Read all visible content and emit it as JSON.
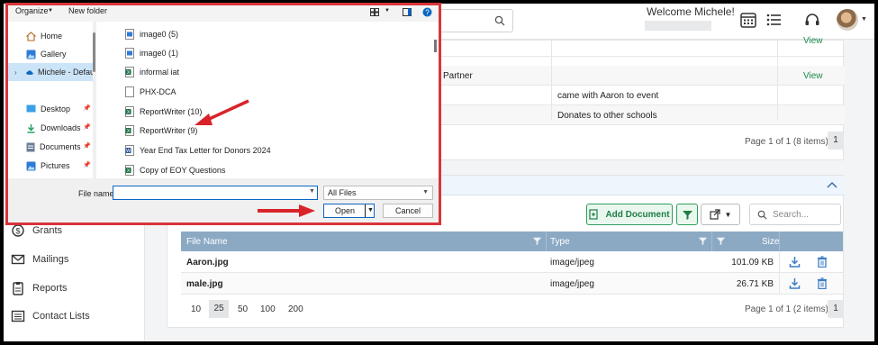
{
  "app": {
    "header": {
      "welcome": "Welcome Michele!",
      "icons": [
        "calendar-icon",
        "list-icon",
        "headset-icon",
        "avatar"
      ]
    },
    "sidebar": {
      "items": [
        {
          "label": "Grants",
          "icon": "grants-icon"
        },
        {
          "label": "Mailings",
          "icon": "mail-icon"
        },
        {
          "label": "Reports",
          "icon": "reports-icon"
        },
        {
          "label": "Contact Lists",
          "icon": "list-icon"
        }
      ]
    },
    "top_panel": {
      "rows": [
        {
          "col1": "",
          "col2": "",
          "col3": "View"
        },
        {
          "col1": "Partner",
          "col2": "",
          "col3": "View"
        },
        {
          "col1": "",
          "col2": "came with Aaron to event",
          "col3": ""
        },
        {
          "col1": "",
          "col2": "Donates to other schools",
          "col3": ""
        }
      ],
      "pager_text": "Page 1 of 1 (8 items)",
      "page": "1"
    },
    "documents": {
      "add_button": "Add Document",
      "search_placeholder": "Search...",
      "columns": {
        "name": "File Name",
        "type": "Type",
        "size": "Size"
      },
      "rows": [
        {
          "name": "Aaron.jpg",
          "type": "image/jpeg",
          "size": "101.09 KB"
        },
        {
          "name": "male.jpg",
          "type": "image/jpeg",
          "size": "26.71 KB"
        }
      ],
      "page_sizes": [
        "10",
        "25",
        "50",
        "100",
        "200"
      ],
      "selected_page_size": "25",
      "pager_text": "Page 1 of 1 (2 items)",
      "page": "1"
    }
  },
  "dialog": {
    "toolbar": {
      "organize": "Organize",
      "new_folder": "New folder"
    },
    "nav": [
      {
        "label": "Home",
        "icon": "home-icon"
      },
      {
        "label": "Gallery",
        "icon": "gallery-icon"
      },
      {
        "label": "Michele - Defau",
        "icon": "onedrive-icon"
      },
      {
        "label": "Desktop",
        "icon": "desktop-icon"
      },
      {
        "label": "Downloads",
        "icon": "downloads-icon"
      },
      {
        "label": "Documents",
        "icon": "documents-icon"
      },
      {
        "label": "Pictures",
        "icon": "pictures-icon"
      }
    ],
    "files": [
      {
        "name": "image0 (5)",
        "icon": "image-file-icon"
      },
      {
        "name": "image0 (1)",
        "icon": "image-file-icon"
      },
      {
        "name": "informal iat",
        "icon": "excel-file-icon"
      },
      {
        "name": "PHX-DCA",
        "icon": "blank-file-icon"
      },
      {
        "name": "ReportWriter (10)",
        "icon": "excel-file-icon"
      },
      {
        "name": "ReportWriter (9)",
        "icon": "excel-file-icon"
      },
      {
        "name": "Year End Tax Letter for Donors 2024",
        "icon": "word-file-icon"
      },
      {
        "name": "Copy of EOY Questions",
        "icon": "excel-file-icon"
      }
    ],
    "file_name_label": "File name:",
    "file_name_value": "",
    "file_type": "All Files",
    "open_label": "Open",
    "cancel_label": "Cancel"
  },
  "colors": {
    "dialog_border": "#d9343a",
    "arrow": "#d9232a",
    "accent_green": "#2f9d5d",
    "grid_header": "#8ca9c4",
    "selection": "#cce4f7"
  }
}
